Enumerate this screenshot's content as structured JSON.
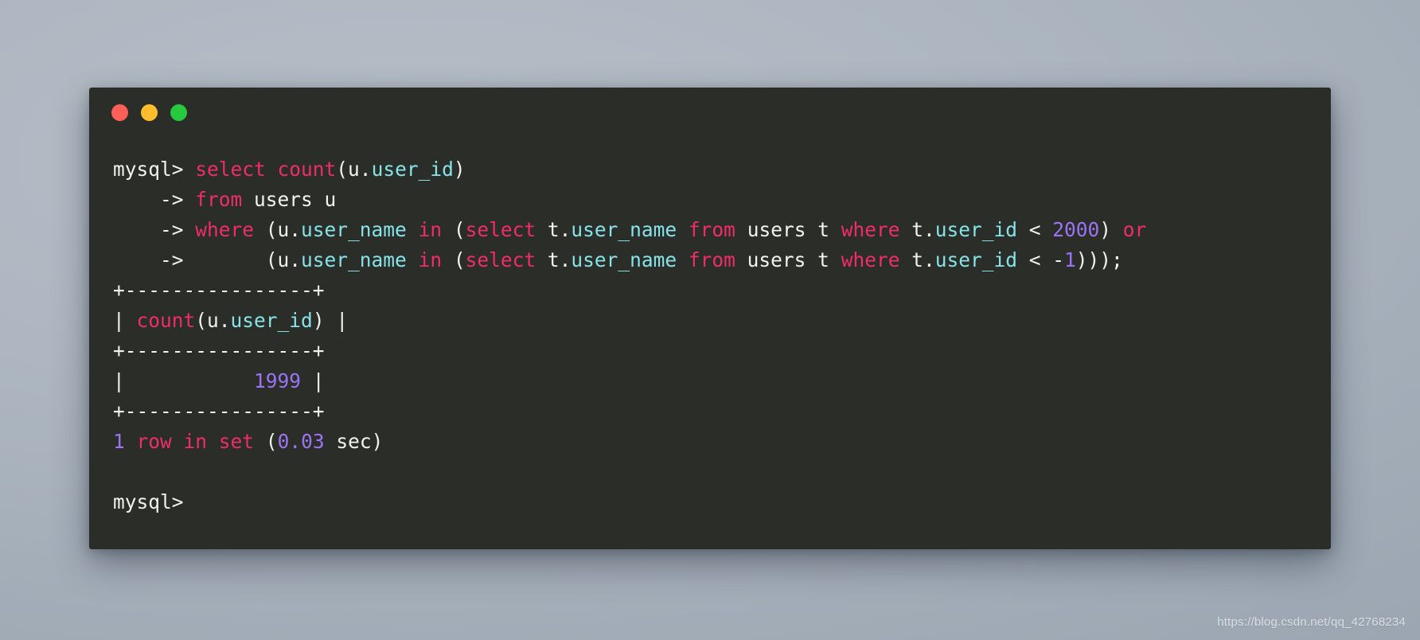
{
  "window": {
    "controls": [
      {
        "name": "close",
        "label": "close-window",
        "color": "#ff5f56"
      },
      {
        "name": "minimize",
        "label": "minimize-window",
        "color": "#ffbd2e"
      },
      {
        "name": "maximize",
        "label": "maximize-window",
        "color": "#27c93f"
      }
    ],
    "background_color": "#2b2d28",
    "page_background": "#aab4bf"
  },
  "theme": {
    "keyword_color": "#ef2d6b",
    "identifier_color": "#86e3e8",
    "number_color": "#9d73f5",
    "text_color": "#f2f2ee"
  },
  "terminal": {
    "prompt": "mysql> ",
    "continuation": "    -> ",
    "lines": [
      {
        "id": "query-line-1",
        "segments": [
          {
            "t": "mysql> ",
            "c": "pr"
          },
          {
            "t": "select ",
            "c": "kw"
          },
          {
            "t": "count",
            "c": "kw"
          },
          {
            "t": "(u.",
            "c": "pl"
          },
          {
            "t": "user_id",
            "c": "id"
          },
          {
            "t": ")",
            "c": "pl"
          }
        ]
      },
      {
        "id": "query-line-2",
        "segments": [
          {
            "t": "    -> ",
            "c": "pl"
          },
          {
            "t": "from ",
            "c": "kw"
          },
          {
            "t": "users u",
            "c": "pl"
          }
        ]
      },
      {
        "id": "query-line-3",
        "segments": [
          {
            "t": "    -> ",
            "c": "pl"
          },
          {
            "t": "where ",
            "c": "kw"
          },
          {
            "t": "(u.",
            "c": "pl"
          },
          {
            "t": "user_name",
            "c": "id"
          },
          {
            "t": " ",
            "c": "pl"
          },
          {
            "t": "in",
            "c": "kw"
          },
          {
            "t": " (",
            "c": "pl"
          },
          {
            "t": "select",
            "c": "kw"
          },
          {
            "t": " t.",
            "c": "pl"
          },
          {
            "t": "user_name",
            "c": "id"
          },
          {
            "t": " ",
            "c": "pl"
          },
          {
            "t": "from",
            "c": "kw"
          },
          {
            "t": " users t ",
            "c": "pl"
          },
          {
            "t": "where",
            "c": "kw"
          },
          {
            "t": " t.",
            "c": "pl"
          },
          {
            "t": "user_id",
            "c": "id"
          },
          {
            "t": " < ",
            "c": "pl"
          },
          {
            "t": "2000",
            "c": "num"
          },
          {
            "t": ") ",
            "c": "pl"
          },
          {
            "t": "or",
            "c": "kw"
          }
        ]
      },
      {
        "id": "query-line-4",
        "segments": [
          {
            "t": "    ->     ",
            "c": "pl"
          },
          {
            "t": "  (u.",
            "c": "pl"
          },
          {
            "t": "user_name",
            "c": "id"
          },
          {
            "t": " ",
            "c": "pl"
          },
          {
            "t": "in",
            "c": "kw"
          },
          {
            "t": " (",
            "c": "pl"
          },
          {
            "t": "select",
            "c": "kw"
          },
          {
            "t": " t.",
            "c": "pl"
          },
          {
            "t": "user_name",
            "c": "id"
          },
          {
            "t": " ",
            "c": "pl"
          },
          {
            "t": "from",
            "c": "kw"
          },
          {
            "t": " users t ",
            "c": "pl"
          },
          {
            "t": "where",
            "c": "kw"
          },
          {
            "t": " t.",
            "c": "pl"
          },
          {
            "t": "user_id",
            "c": "id"
          },
          {
            "t": " < -",
            "c": "pl"
          },
          {
            "t": "1",
            "c": "num"
          },
          {
            "t": ")));",
            "c": "pl"
          }
        ]
      },
      {
        "id": "result-border-top",
        "segments": [
          {
            "t": "+----------------+",
            "c": "pl"
          }
        ]
      },
      {
        "id": "result-header-row",
        "segments": [
          {
            "t": "| ",
            "c": "pl"
          },
          {
            "t": "count",
            "c": "kw"
          },
          {
            "t": "(u.",
            "c": "pl"
          },
          {
            "t": "user_id",
            "c": "id"
          },
          {
            "t": ") |",
            "c": "pl"
          }
        ]
      },
      {
        "id": "result-border-mid",
        "segments": [
          {
            "t": "+----------------+",
            "c": "pl"
          }
        ]
      },
      {
        "id": "result-value-row",
        "segments": [
          {
            "t": "|           ",
            "c": "pl"
          },
          {
            "t": "1999",
            "c": "num"
          },
          {
            "t": " |",
            "c": "pl"
          }
        ]
      },
      {
        "id": "result-border-bottom",
        "segments": [
          {
            "t": "+----------------+",
            "c": "pl"
          }
        ]
      },
      {
        "id": "status-line",
        "segments": [
          {
            "t": "1",
            "c": "num"
          },
          {
            "t": " ",
            "c": "pl"
          },
          {
            "t": "row in set",
            "c": "kw"
          },
          {
            "t": " (",
            "c": "pl"
          },
          {
            "t": "0.03",
            "c": "num"
          },
          {
            "t": " sec)",
            "c": "pl"
          }
        ]
      },
      {
        "id": "blank-line",
        "segments": [
          {
            "t": " ",
            "c": "pl"
          }
        ]
      },
      {
        "id": "prompt-line-final",
        "segments": [
          {
            "t": "mysql>",
            "c": "pr"
          }
        ]
      }
    ],
    "result": {
      "column_header": "count(u.user_id)",
      "value": "1999",
      "rows_returned": "1",
      "duration_seconds": "0.03",
      "status_text": "1 row in set (0.03 sec)"
    }
  },
  "watermark": {
    "text": "https://blog.csdn.net/qq_42768234"
  }
}
